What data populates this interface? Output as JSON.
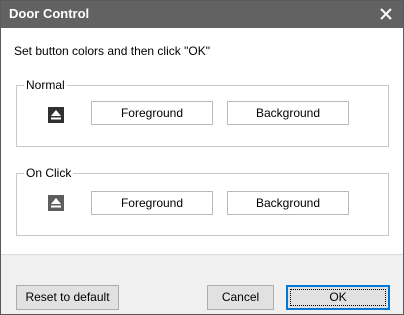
{
  "window": {
    "title": "Door Control"
  },
  "instruction": "Set button colors and then click \"OK\"",
  "groups": [
    {
      "legend": "Normal",
      "icon": "eject-icon",
      "foreground_label": "Foreground",
      "background_label": "Background"
    },
    {
      "legend": "On Click",
      "icon": "eject-icon",
      "foreground_label": "Foreground",
      "background_label": "Background"
    }
  ],
  "footer": {
    "reset_label": "Reset to default",
    "cancel_label": "Cancel",
    "ok_label": "OK"
  },
  "colors": {
    "titlebar": "#626262",
    "normal_icon_bg": "#2f2f2f",
    "onclick_icon_bg": "#5e5e5e",
    "icon_fg": "#ffffff",
    "accent": "#0078d7"
  }
}
